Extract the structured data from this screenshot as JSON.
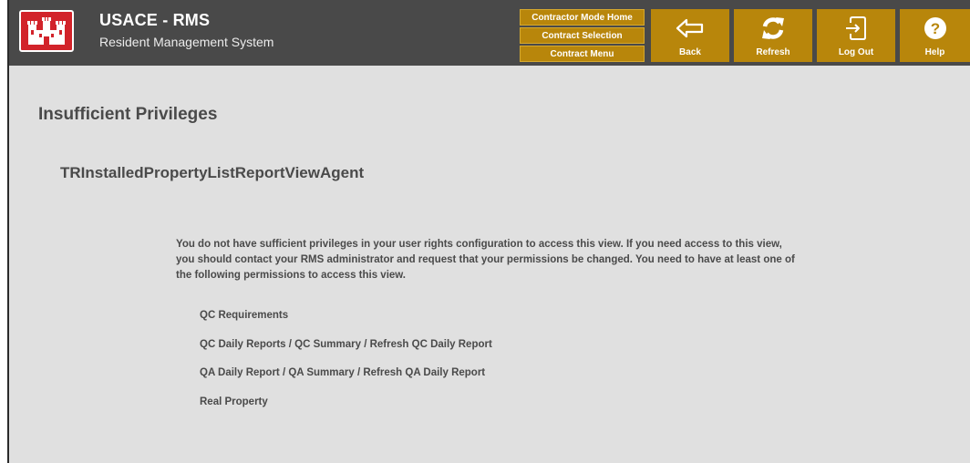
{
  "header": {
    "app_title": "USACE - RMS",
    "app_subtitle": "Resident Management System",
    "nav_links": [
      "Contractor Mode Home",
      "Contract Selection",
      "Contract Menu"
    ],
    "buttons": {
      "back": "Back",
      "refresh": "Refresh",
      "logout": "Log Out",
      "help": "Help"
    }
  },
  "main": {
    "heading": "Insufficient Privileges",
    "view_name": "TRInstalledPropertyListReportViewAgent",
    "message": "You do not have sufficient privileges in your user rights configuration to access this view. If you need access to this view, you should contact your RMS administrator and request that your permissions be changed. You need to have at least one of the following permissions to access this view.",
    "permissions": [
      "QC Requirements",
      "QC Daily Reports / QC Summary / Refresh QC Daily Report",
      "QA Daily Report / QA Summary / Refresh QA Daily Report",
      "Real Property"
    ]
  },
  "colors": {
    "header_bg": "#494949",
    "button_gold": "#b8860b",
    "logo_red": "#d2232a",
    "page_bg": "#e0e0e0"
  },
  "icons": [
    "castle-logo-icon",
    "back-arrow-icon",
    "refresh-icon",
    "logout-icon",
    "help-icon"
  ]
}
